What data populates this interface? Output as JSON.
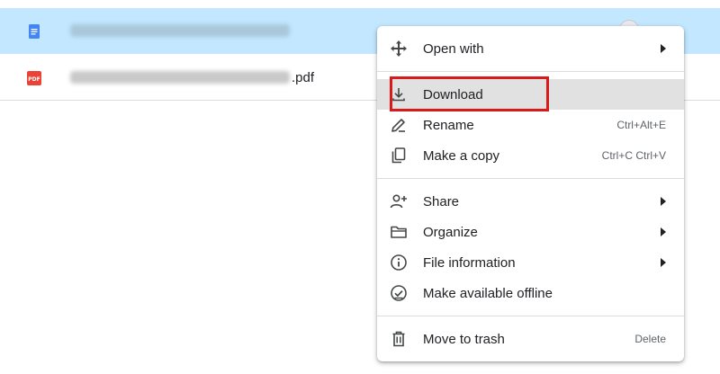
{
  "files": [
    {
      "icon": "google-docs-icon",
      "ext": "",
      "selected": true
    },
    {
      "icon": "pdf-icon",
      "ext": ".pdf",
      "selected": false,
      "badge": "PDF"
    }
  ],
  "context_menu": {
    "items": [
      {
        "id": "open-with",
        "label": "Open with",
        "icon": "move-arrows-icon",
        "submenu": true
      },
      {
        "id": "download",
        "label": "Download",
        "icon": "download-icon",
        "highlighted": true
      },
      {
        "id": "rename",
        "label": "Rename",
        "icon": "pencil-icon",
        "shortcut": "Ctrl+Alt+E"
      },
      {
        "id": "make-a-copy",
        "label": "Make a copy",
        "icon": "copy-icon",
        "shortcut": "Ctrl+C Ctrl+V"
      },
      {
        "id": "share",
        "label": "Share",
        "icon": "person-add-icon",
        "submenu": true
      },
      {
        "id": "organize",
        "label": "Organize",
        "icon": "folder-icon",
        "submenu": true
      },
      {
        "id": "file-information",
        "label": "File information",
        "icon": "info-icon",
        "submenu": true
      },
      {
        "id": "make-available-offline",
        "label": "Make available offline",
        "icon": "offline-check-icon"
      },
      {
        "id": "move-to-trash",
        "label": "Move to trash",
        "icon": "trash-icon",
        "shortcut": "Delete"
      }
    ]
  },
  "colors": {
    "selected_row": "#c2e7ff",
    "highlight": "#e1e1e1",
    "callout": "#d91a1a",
    "docs_blue": "#4285f4",
    "pdf_red": "#ea4335"
  }
}
